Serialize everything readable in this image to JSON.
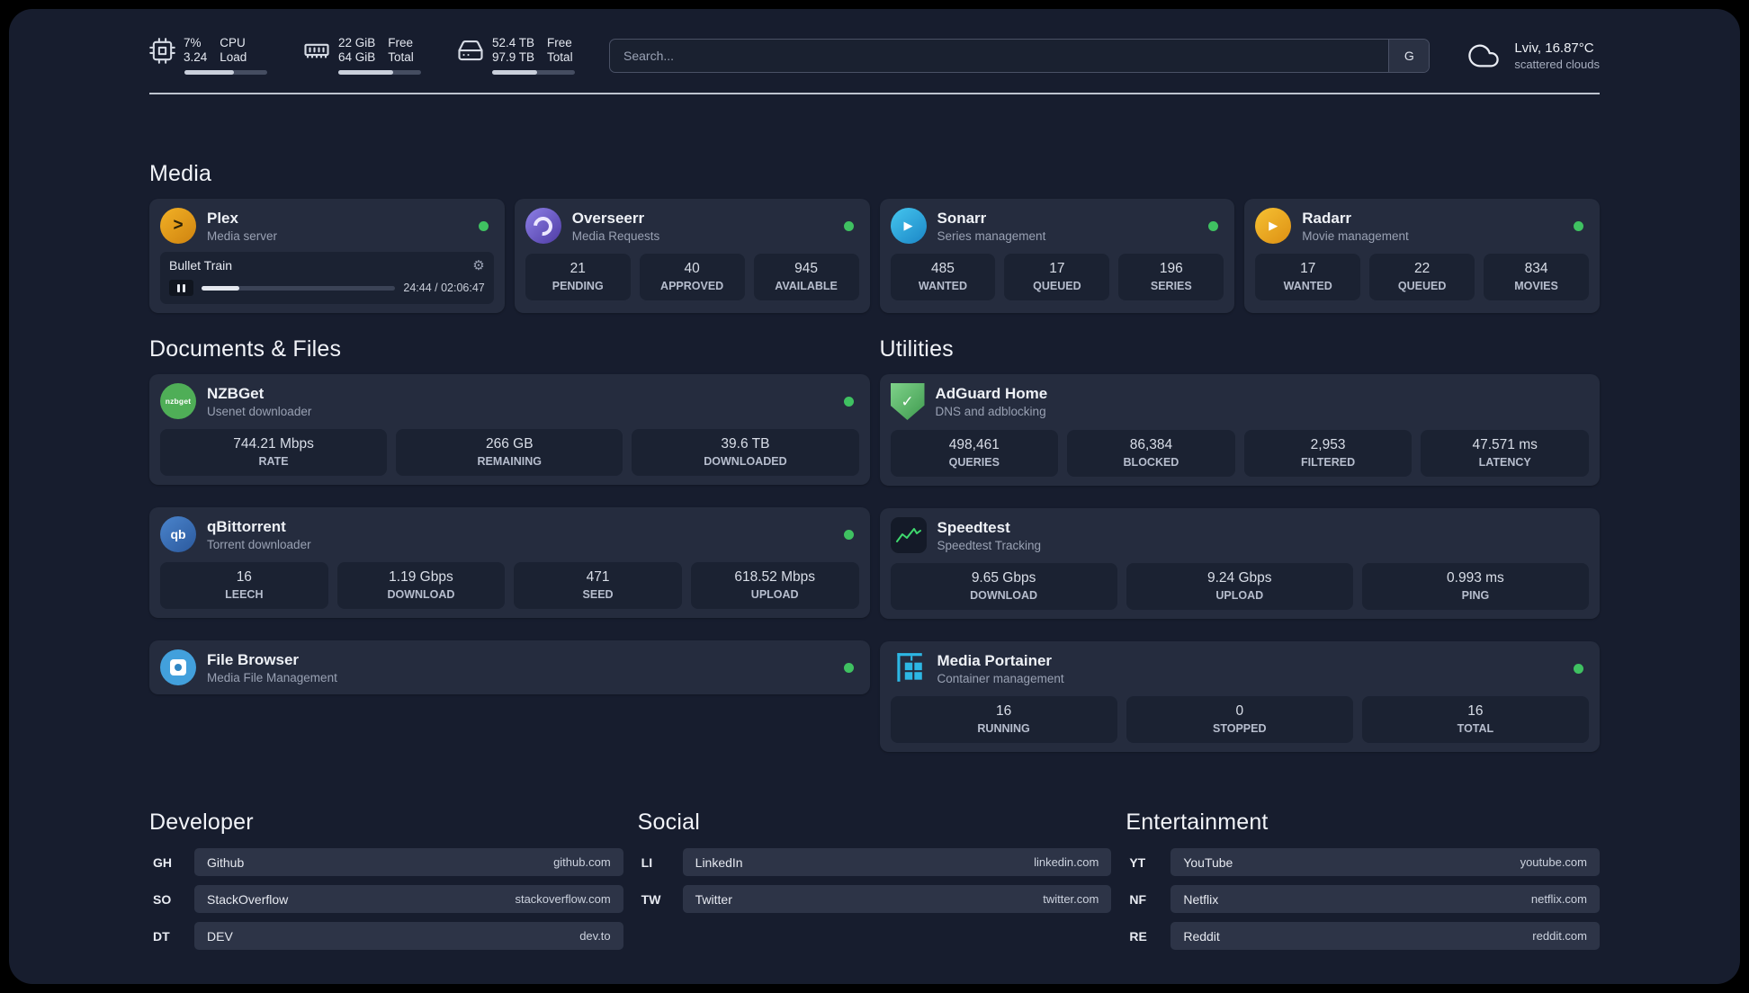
{
  "colors": {
    "background": "#171d2e",
    "card": "#252c3e",
    "tile": "#1b2232",
    "status_online": "#3fc161",
    "progress_fill": "#c9cfdb",
    "accent_plex": "#f2b126",
    "accent_overseerr": "#8d80e6",
    "accent_sonarr": "#45c6ef",
    "accent_radarr": "#f6c133",
    "accent_nzbget": "#4fae57",
    "accent_qbittorrent": "#4a84cc",
    "accent_adguard": "#3e9a4e",
    "accent_speedtest": "#3fd96e",
    "accent_filebrowser": "#42a0dc",
    "accent_portainer": "#2db7e4"
  },
  "glyphs": {
    "plex": ">",
    "sonarr": "▶",
    "radarr": "▶",
    "nzbget": "nzbget",
    "qb": "qb",
    "adguard": "✓",
    "gear": "⚙"
  },
  "header": {
    "metrics": [
      {
        "icon": "cpu-icon",
        "rows": [
          {
            "value": "7%",
            "label": "CPU"
          },
          {
            "value": "3.24",
            "label": "Load"
          }
        ],
        "progress": "60%"
      },
      {
        "icon": "ram-icon",
        "rows": [
          {
            "value": "22 GiB",
            "label": "Free"
          },
          {
            "value": "64 GiB",
            "label": "Total"
          }
        ],
        "progress": "66%"
      },
      {
        "icon": "disk-icon",
        "rows": [
          {
            "value": "52.4 TB",
            "label": "Free"
          },
          {
            "value": "97.9 TB",
            "label": "Total"
          }
        ],
        "progress": "54%"
      }
    ],
    "search": {
      "placeholder": "Search...",
      "engine_button": "G"
    },
    "weather": {
      "icon": "cloud-icon",
      "location": "Lviv, 16.87°C",
      "condition": "scattered clouds"
    }
  },
  "sections": {
    "media": {
      "title": "Media",
      "cards": [
        {
          "icon": "plex-icon",
          "name": "Plex",
          "desc": "Media server",
          "online": true,
          "player": {
            "track": "Bullet Train",
            "time": "24:44 / 02:06:47",
            "progress": "19.5%"
          }
        },
        {
          "icon": "overseerr-icon",
          "name": "Overseerr",
          "desc": "Media Requests",
          "online": true,
          "stats": [
            {
              "value": "21",
              "label": "PENDING"
            },
            {
              "value": "40",
              "label": "APPROVED"
            },
            {
              "value": "945",
              "label": "AVAILABLE"
            }
          ]
        },
        {
          "icon": "sonarr-icon",
          "name": "Sonarr",
          "desc": "Series management",
          "online": true,
          "stats": [
            {
              "value": "485",
              "label": "WANTED"
            },
            {
              "value": "17",
              "label": "QUEUED"
            },
            {
              "value": "196",
              "label": "SERIES"
            }
          ]
        },
        {
          "icon": "radarr-icon",
          "name": "Radarr",
          "desc": "Movie management",
          "online": true,
          "stats": [
            {
              "value": "17",
              "label": "WANTED"
            },
            {
              "value": "22",
              "label": "QUEUED"
            },
            {
              "value": "834",
              "label": "MOVIES"
            }
          ]
        }
      ]
    },
    "documents": {
      "title": "Documents & Files",
      "cards": [
        {
          "icon": "nzbget-icon",
          "name": "NZBGet",
          "desc": "Usenet downloader",
          "online": true,
          "stats": [
            {
              "value": "744.21 Mbps",
              "label": "RATE"
            },
            {
              "value": "266 GB",
              "label": "REMAINING"
            },
            {
              "value": "39.6 TB",
              "label": "DOWNLOADED"
            }
          ]
        },
        {
          "icon": "qbittorrent-icon",
          "name": "qBittorrent",
          "desc": "Torrent downloader",
          "online": true,
          "stats": [
            {
              "value": "16",
              "label": "LEECH"
            },
            {
              "value": "1.19 Gbps",
              "label": "DOWNLOAD"
            },
            {
              "value": "471",
              "label": "SEED"
            },
            {
              "value": "618.52 Mbps",
              "label": "UPLOAD"
            }
          ]
        },
        {
          "icon": "filebrowser-icon",
          "name": "File Browser",
          "desc": "Media File Management",
          "online": true
        }
      ]
    },
    "utilities": {
      "title": "Utilities",
      "cards": [
        {
          "icon": "adguard-icon",
          "name": "AdGuard Home",
          "desc": "DNS and adblocking",
          "stats": [
            {
              "value": "498,461",
              "label": "QUERIES"
            },
            {
              "value": "86,384",
              "label": "BLOCKED"
            },
            {
              "value": "2,953",
              "label": "FILTERED"
            },
            {
              "value": "47.571 ms",
              "label": "LATENCY"
            }
          ]
        },
        {
          "icon": "speedtest-icon",
          "name": "Speedtest",
          "desc": "Speedtest Tracking",
          "stats": [
            {
              "value": "9.65 Gbps",
              "label": "DOWNLOAD"
            },
            {
              "value": "9.24 Gbps",
              "label": "UPLOAD"
            },
            {
              "value": "0.993 ms",
              "label": "PING"
            }
          ]
        },
        {
          "icon": "portainer-icon",
          "name": "Media Portainer",
          "desc": "Container management",
          "online": true,
          "stats": [
            {
              "value": "16",
              "label": "RUNNING"
            },
            {
              "value": "0",
              "label": "STOPPED"
            },
            {
              "value": "16",
              "label": "TOTAL"
            }
          ]
        }
      ]
    }
  },
  "bookmarks": [
    {
      "title": "Developer",
      "items": [
        {
          "abbr": "GH",
          "name": "Github",
          "url": "github.com"
        },
        {
          "abbr": "SO",
          "name": "StackOverflow",
          "url": "stackoverflow.com"
        },
        {
          "abbr": "DT",
          "name": "DEV",
          "url": "dev.to"
        }
      ]
    },
    {
      "title": "Social",
      "items": [
        {
          "abbr": "LI",
          "name": "LinkedIn",
          "url": "linkedin.com"
        },
        {
          "abbr": "TW",
          "name": "Twitter",
          "url": "twitter.com"
        }
      ]
    },
    {
      "title": "Entertainment",
      "items": [
        {
          "abbr": "YT",
          "name": "YouTube",
          "url": "youtube.com"
        },
        {
          "abbr": "NF",
          "name": "Netflix",
          "url": "netflix.com"
        },
        {
          "abbr": "RE",
          "name": "Reddit",
          "url": "reddit.com"
        }
      ]
    }
  ]
}
